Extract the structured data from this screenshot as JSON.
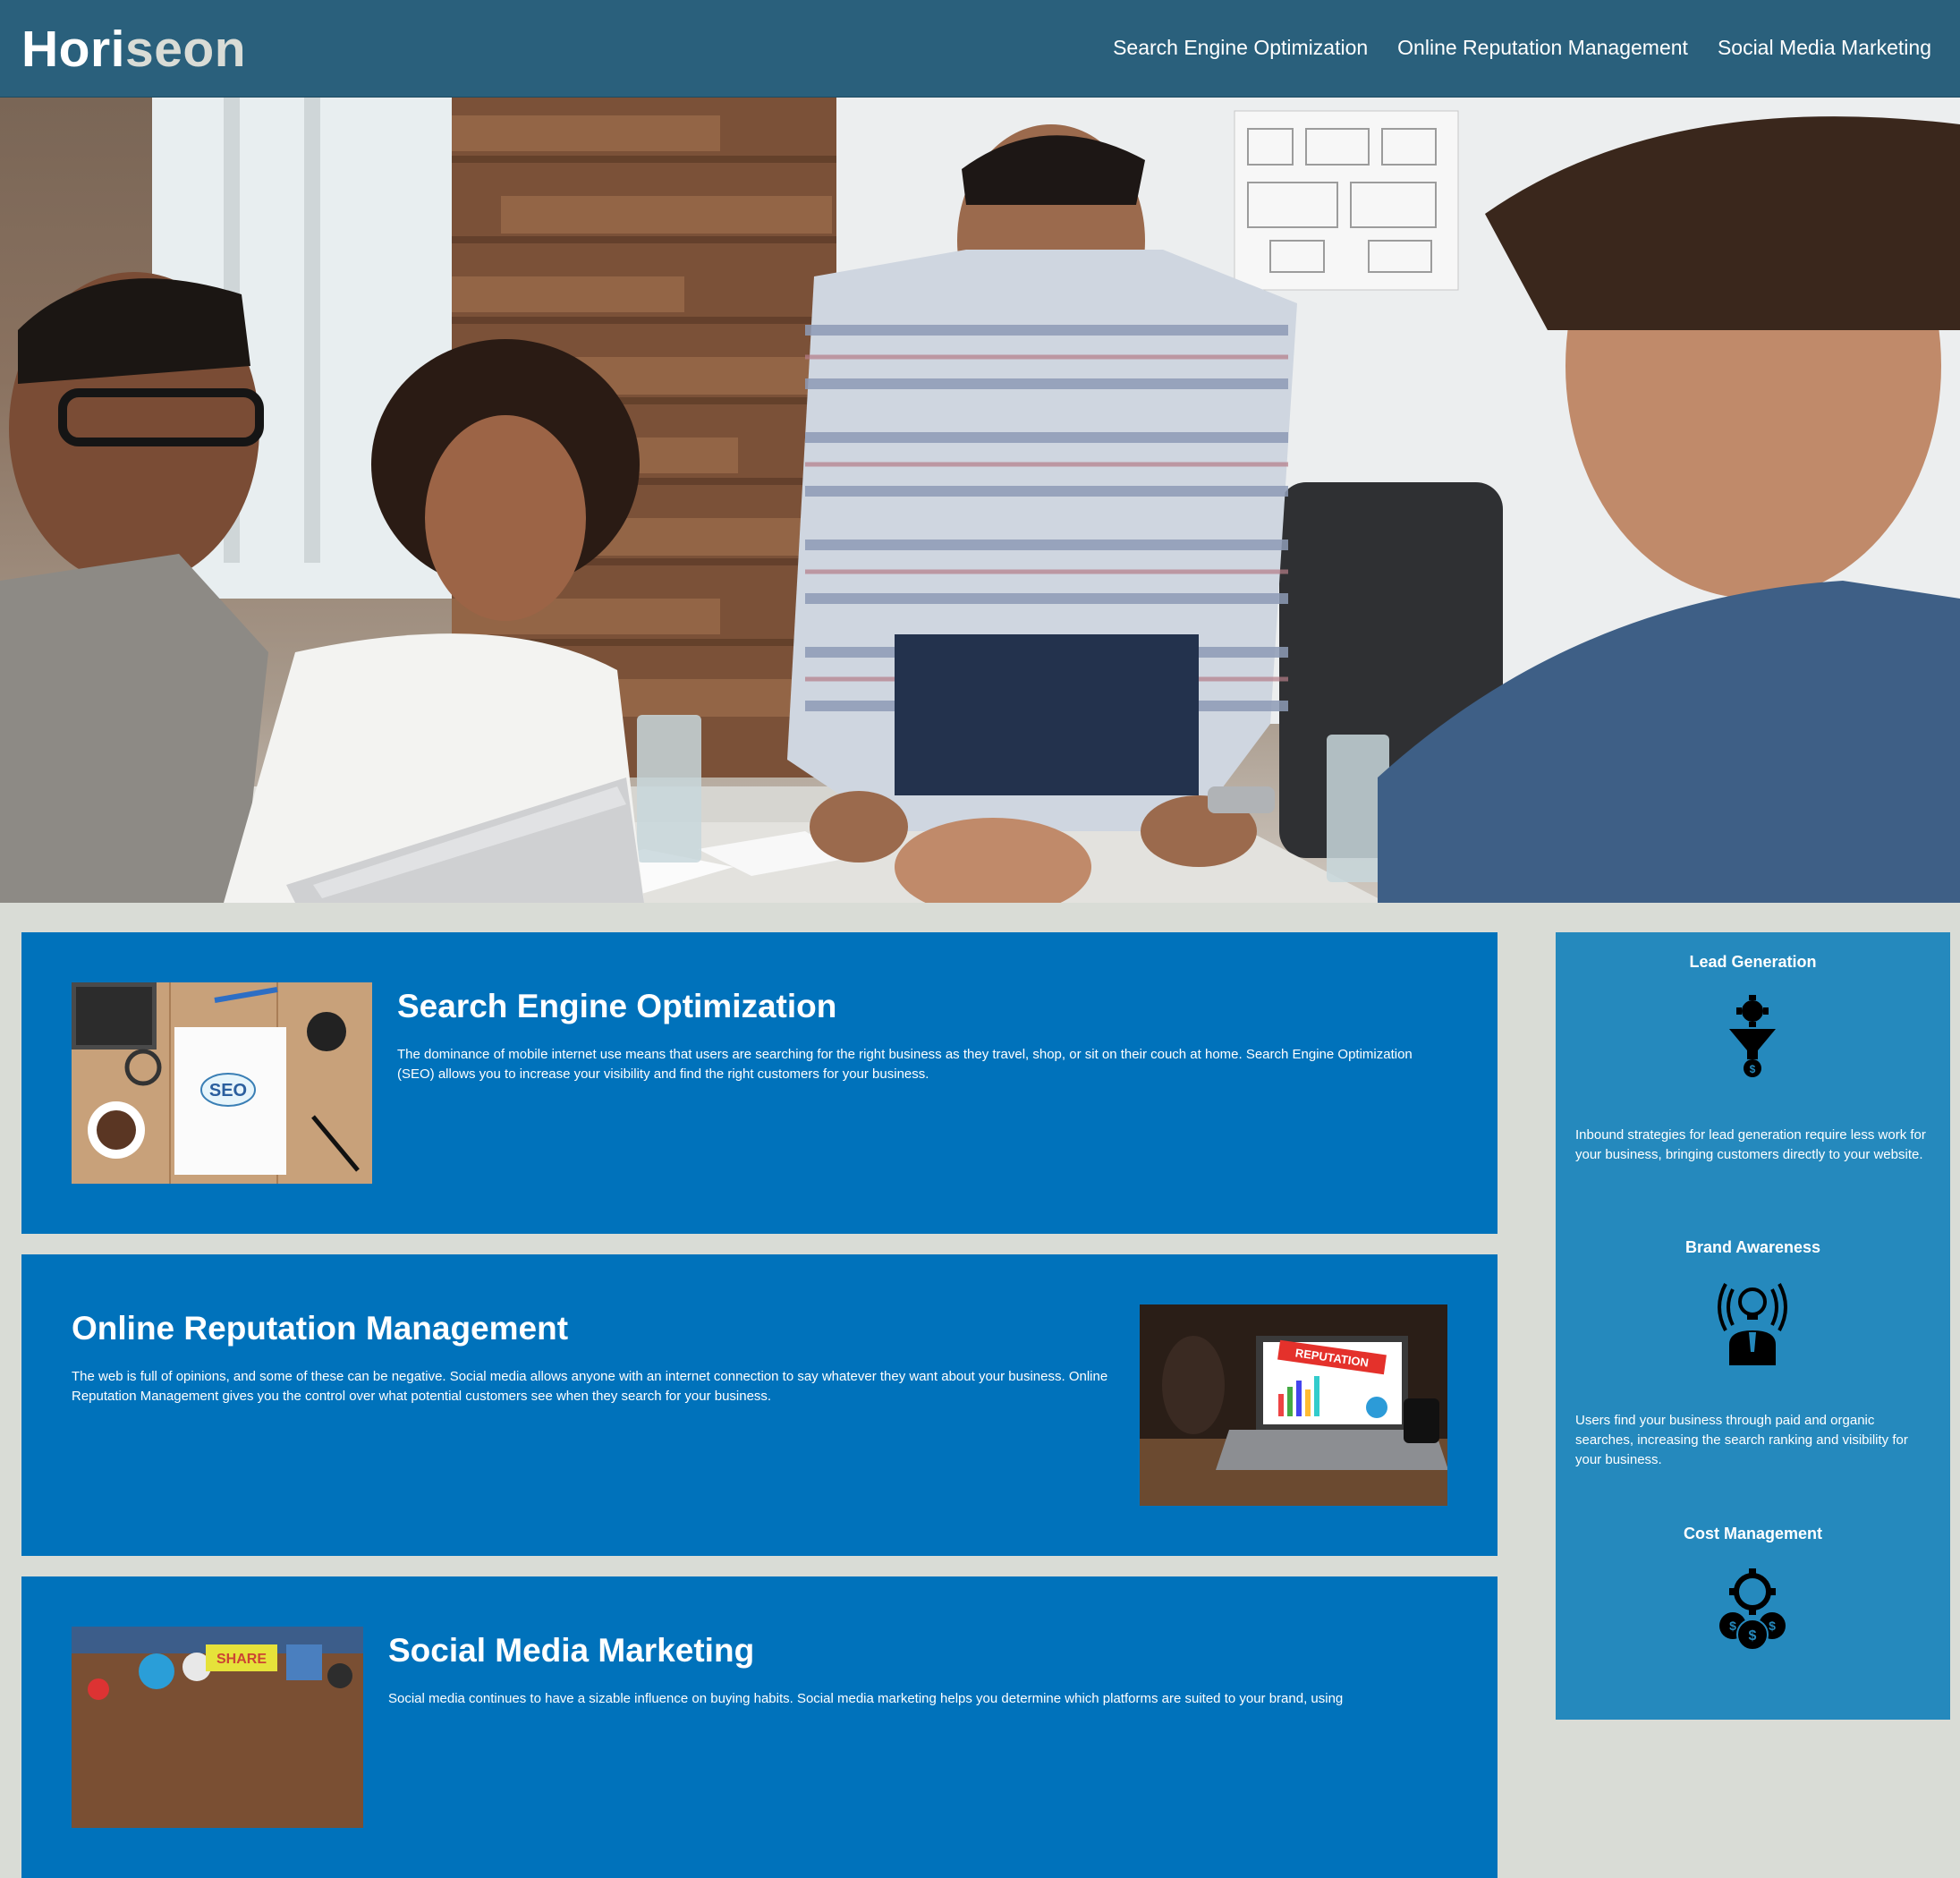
{
  "header": {
    "logo_part1": "Hori",
    "logo_part2": "seon",
    "nav": [
      "Search Engine Optimization",
      "Online Reputation Management",
      "Social Media Marketing"
    ]
  },
  "colors": {
    "header_bg": "#2a607c",
    "page_bg": "#d9dcd6",
    "card_bg": "#0072bb",
    "sidebar_bg": "#2589bd"
  },
  "sections": [
    {
      "title": "Search Engine Optimization",
      "text": "The dominance of mobile internet use means that users are searching for the right business as they travel, shop, or sit on their couch at home. Search Engine Optimization (SEO) allows you to increase your visibility and find the right customers for your business.",
      "image_text": "SEO"
    },
    {
      "title": "Online Reputation Management",
      "text": "The web is full of opinions, and some of these can be negative. Social media allows anyone with an internet connection to say whatever they want about your business. Online Reputation Management gives you the control over what potential customers see when they search for your business.",
      "image_text": "REPUTATION"
    },
    {
      "title": "Social Media Marketing",
      "text": "Social media continues to have a sizable influence on buying habits. Social media marketing helps you determine which platforms are suited to your brand, using",
      "image_text": "SHARE"
    }
  ],
  "benefits": [
    {
      "title": "Lead Generation",
      "icon": "funnel-money-icon",
      "text": "Inbound strategies for lead generation require less work for your business, bringing customers directly to your website."
    },
    {
      "title": "Brand Awareness",
      "icon": "lightbulb-person-icon",
      "text": "Users find your business through paid and organic searches, increasing the search ranking and visibility for your business."
    },
    {
      "title": "Cost Management",
      "icon": "gear-coins-icon",
      "text": ""
    }
  ]
}
